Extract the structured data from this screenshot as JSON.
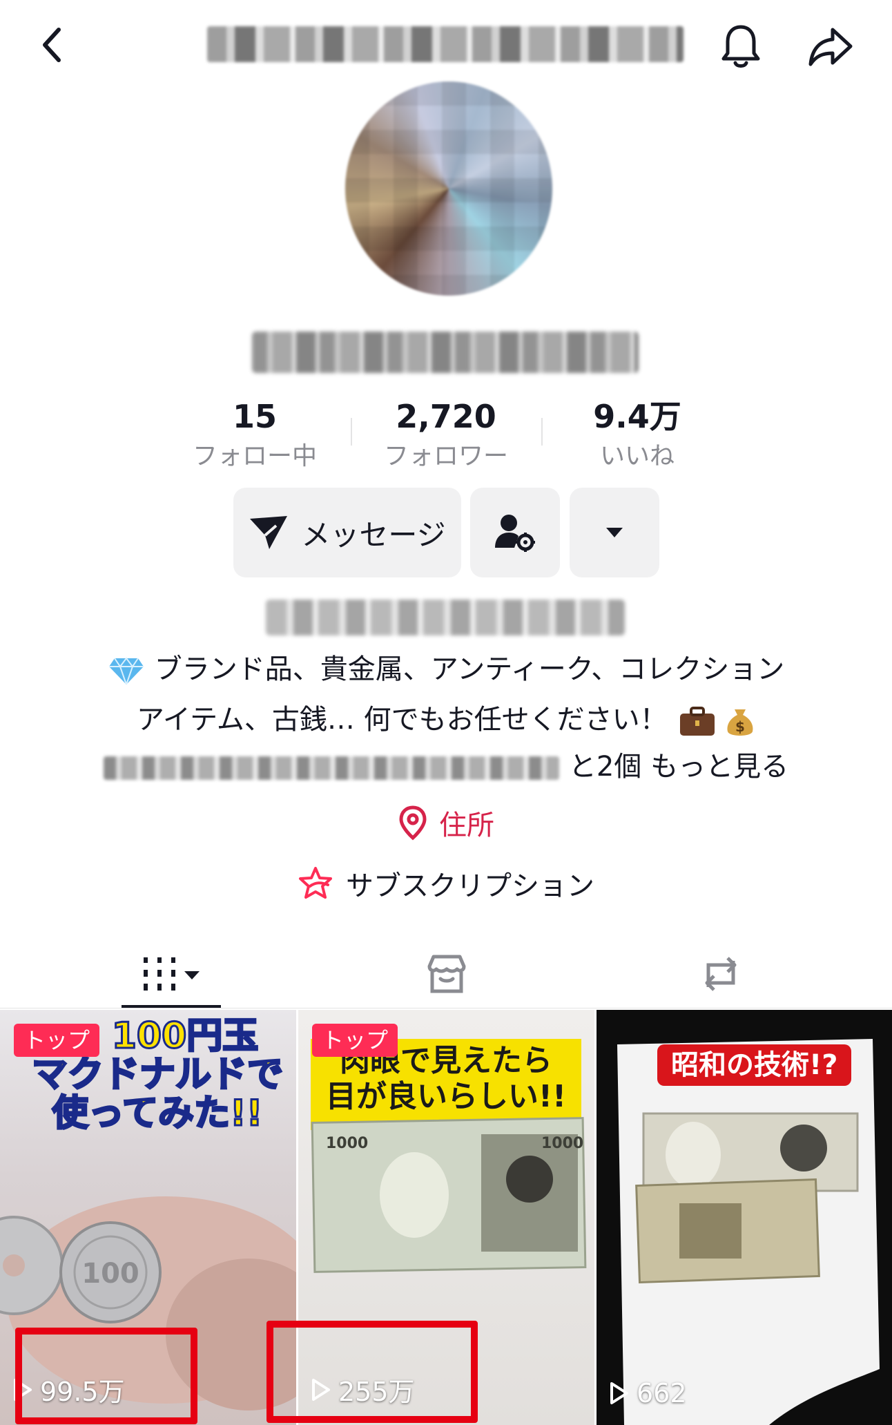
{
  "stats": [
    {
      "value": "15",
      "label": "フォロー中"
    },
    {
      "value": "2,720",
      "label": "フォロワー"
    },
    {
      "value": "9.4万",
      "label": "いいね"
    }
  ],
  "actions": {
    "message_label": "メッセージ"
  },
  "bio": {
    "line1": "ブランド品、貴金属、アンティーク、コレクション",
    "line2": "アイテム、古銭… 何でもお任せください！",
    "more_count": "と2個",
    "more_link": "もっと見る"
  },
  "address_label": "住所",
  "subscription_label": "サブスクリプション",
  "videos": [
    {
      "badge": "トップ",
      "views": "99.5万",
      "caption_line1": "100円玉",
      "caption_line2": "マクドナルドで",
      "caption_line3": "使ってみた!!"
    },
    {
      "badge": "トップ",
      "views": "255万",
      "caption_line1": "肉眼で見えたら",
      "caption_line2": "目が良いらしい!!"
    },
    {
      "badge": "",
      "views": "662",
      "caption_line1": "昭和の技術!?"
    }
  ],
  "colors": {
    "accent": "#fe2c55",
    "address": "#d6234a",
    "highlight": "#e60012"
  }
}
